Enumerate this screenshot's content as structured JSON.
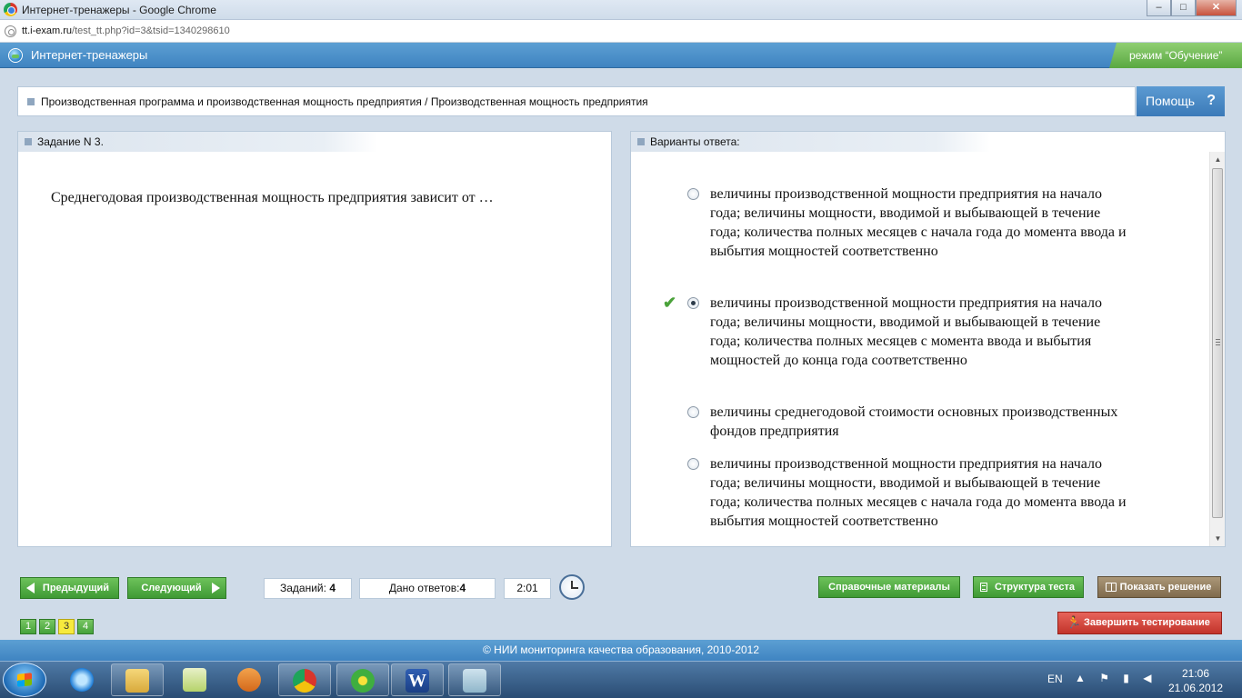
{
  "browser": {
    "window_title": "Интернет-тренажеры - Google Chrome",
    "url_host": "tt.i-exam.ru",
    "url_path": "/test_tt.php?id=3&tsid=1340298610",
    "buttons": {
      "minimize": "–",
      "maximize": "□",
      "close": "✕"
    }
  },
  "header": {
    "app_title": "Интернет-тренажеры",
    "mode": "режим “Обучение”"
  },
  "breadcrumb": "Производственная программа и производственная мощность предприятия / Производственная мощность предприятия",
  "help_label": "Помощь",
  "help_icon": "?",
  "task": {
    "title": "Задание N 3.",
    "question": "Среднегодовая производственная мощность предприятия зависит от …"
  },
  "answers": {
    "title": "Варианты ответа:",
    "options": [
      {
        "text": "величины производственной мощности предприятия на начало года; величины мощности, вводимой и выбывающей в течение года; количества полных месяцев с начала года до момента ввода и выбытия мощностей соответственно",
        "selected": false
      },
      {
        "text": "величины производственной мощности предприятия на начало года; величины мощности, вводимой и выбывающей в течение года; количества полных месяцев с момента ввода и выбытия мощностей до конца года соответственно",
        "selected": true,
        "correct_mark": "✔"
      },
      {
        "text": "величины среднегодовой стоимости основных производственных фондов предприятия",
        "selected": false
      },
      {
        "text": "величины производственной мощности предприятия на начало года; величины мощности, вводимой и выбывающей в течение года; количества полных месяцев с начала года до момента ввода и выбытия мощностей соответственно",
        "selected": false
      }
    ]
  },
  "nav": {
    "prev_label": "Предыдущий",
    "next_label": "Следующий"
  },
  "stats": {
    "tasks_label": "Заданий:",
    "tasks_value": "4",
    "answered_label": "Дано ответов:",
    "answered_value": "4",
    "timer": "2:01"
  },
  "actions": {
    "reference": "Справочные материалы",
    "structure": "Структура теста",
    "solution": "Показать решение",
    "finish": "Завершить тестирование"
  },
  "pages": [
    "1",
    "2",
    "3",
    "4"
  ],
  "current_page": "3",
  "footer": "© НИИ мониторинга качества образования, 2010-2012",
  "taskbar": {
    "lang": "EN",
    "tray": "▲ ⚑ ▮ ◀",
    "time": "21:06",
    "date": "21.06.2012",
    "word_letter": "W"
  },
  "colors": {
    "header_blue": "#4a8fc9",
    "mode_green": "#6dbd55",
    "button_green": "#4fa83f",
    "solution_brown": "#8e7a5a",
    "finish_red": "#d2443a",
    "current_page_yellow": "#f7ea3d"
  }
}
